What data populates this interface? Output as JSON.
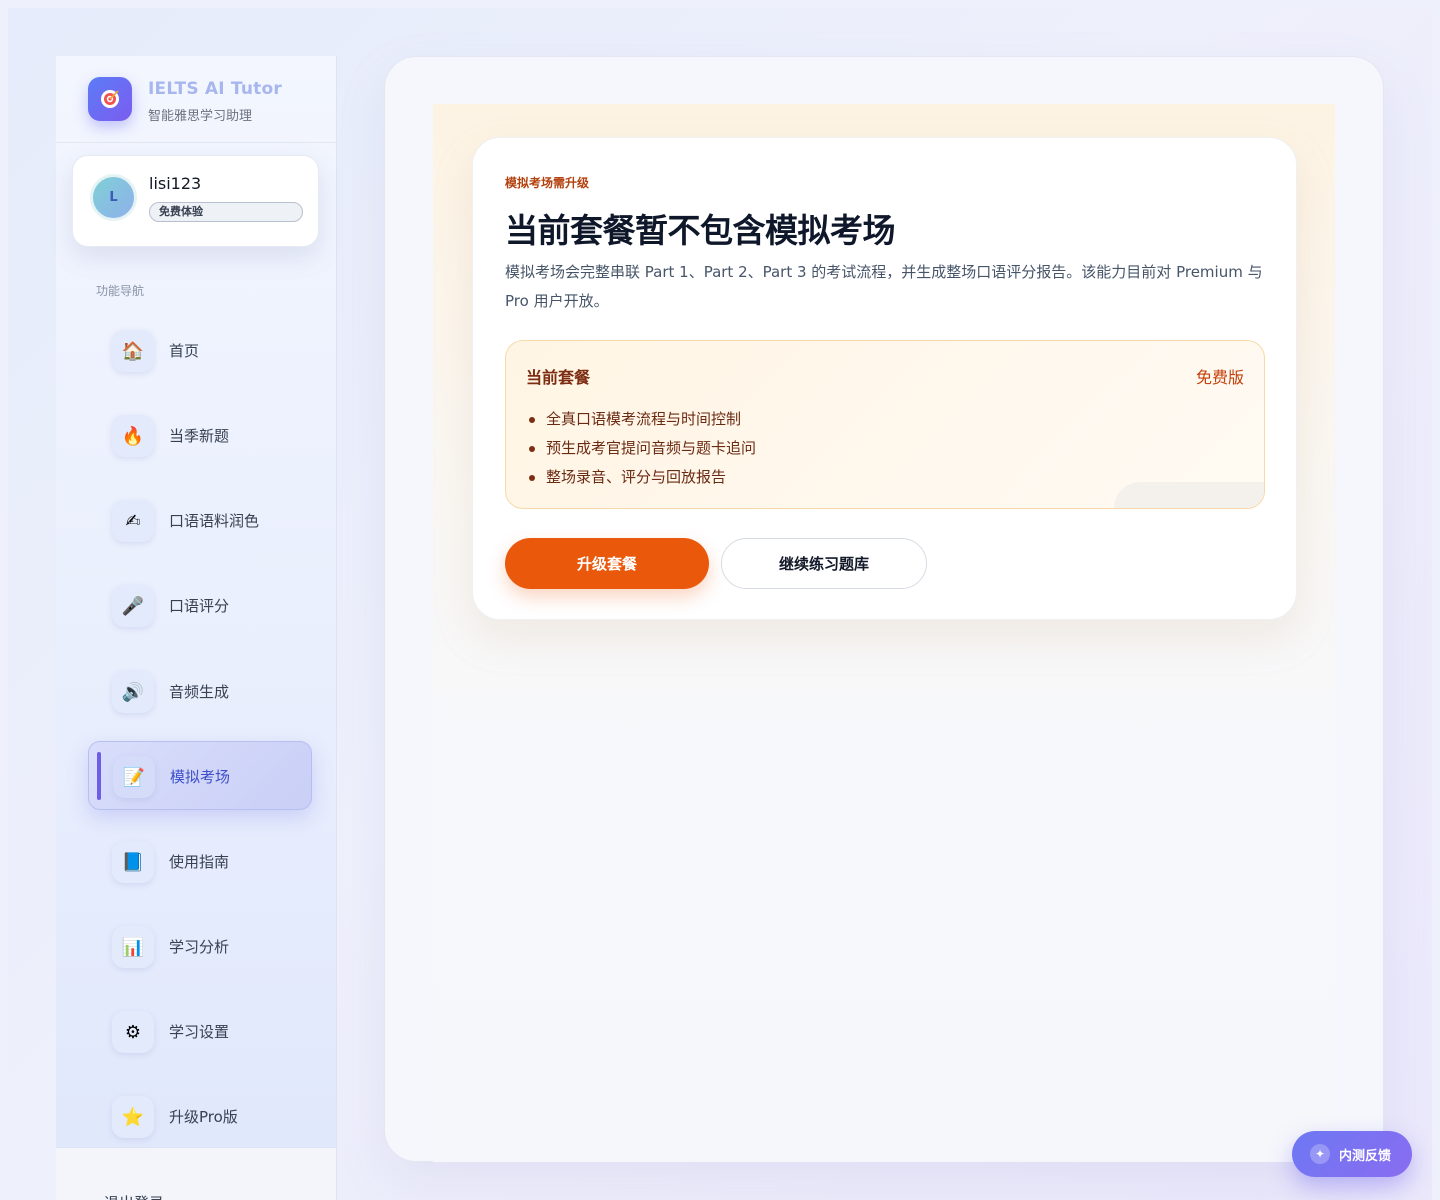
{
  "brand": {
    "title": "IELTS AI Tutor",
    "subtitle": "智能雅思学习助理",
    "logo_icon": "target-icon"
  },
  "user": {
    "avatar_initial": "L",
    "username": "lisi123",
    "plan_badge": "免费体验"
  },
  "nav": {
    "section_title": "功能导航",
    "items": [
      {
        "label": "首页",
        "icon": "🏠"
      },
      {
        "label": "当季新题",
        "icon": "🔥"
      },
      {
        "label": "口语语料润色",
        "icon": "✍"
      },
      {
        "label": "口语评分",
        "icon": "🎤"
      },
      {
        "label": "音频生成",
        "icon": "🔊"
      },
      {
        "label": "模拟考场",
        "icon": "📝",
        "active": true
      },
      {
        "label": "使用指南",
        "icon": "📘"
      },
      {
        "label": "学习分析",
        "icon": "📊"
      },
      {
        "label": "学习设置",
        "icon": "⚙"
      },
      {
        "label": "升级Pro版",
        "icon": "⭐"
      }
    ],
    "logout_label": "退出登录"
  },
  "card": {
    "eyebrow": "模拟考场需升级",
    "title": "当前套餐暂不包含模拟考场",
    "description": "模拟考场会完整串联 Part 1、Part 2、Part 3 的考试流程，并生成整场口语评分报告。该能力目前对 Premium 与 Pro 用户开放。",
    "plan_label": "当前套餐",
    "plan_value": "免费版",
    "features": [
      "全真口语模考流程与时间控制",
      "预生成考官提问音频与题卡追问",
      "整场录音、评分与回放报告"
    ],
    "upgrade_button": "升级套餐",
    "continue_button": "继续练习题库"
  },
  "feedback": {
    "label": "内测反馈",
    "icon": "sparkle-icon"
  },
  "colors": {
    "accent": "#ea580c",
    "nav_active": "#6f5ce8",
    "eyebrow": "#b3410e"
  }
}
